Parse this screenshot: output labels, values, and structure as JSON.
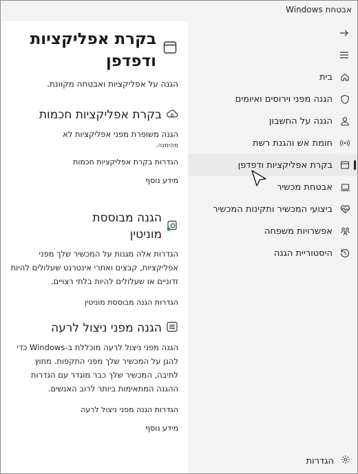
{
  "window": {
    "title": "אבטחת Windows"
  },
  "nav": {
    "items": [
      {
        "label": "בית",
        "icon": "home-icon"
      },
      {
        "label": "הגנה מפני וירוסים ואיומים",
        "icon": "shield-icon"
      },
      {
        "label": "הגנה על החשבון",
        "icon": "person-icon"
      },
      {
        "label": "חומת אש והגנת רשת",
        "icon": "wireless-icon"
      },
      {
        "label": "בקרת אפליקציות ודפדפן",
        "icon": "app-browser-icon",
        "selected": true
      },
      {
        "label": "אבטחת מכשיר",
        "icon": "laptop-icon"
      },
      {
        "label": "ביצועי המכשיר ותקינות המכשיר",
        "icon": "heart-pulse-icon"
      },
      {
        "label": "אפשרויות משפחה",
        "icon": "family-icon"
      },
      {
        "label": "היסטוריית הגנה",
        "icon": "history-icon"
      }
    ],
    "settings_label": "הגדרות"
  },
  "page": {
    "title": "בקרת אפליקציות ודפדפן",
    "subtitle": "הגנה על אפליקציות ואבטחה מקוונת."
  },
  "sections": {
    "smart_app": {
      "title": "בקרת אפליקציות חכמות",
      "text": "הגנה משופרת מפני אפליקציות לא",
      "small": "מהימנה.",
      "settings_link": "הגדרות בקרת אפליקציות חכמות",
      "more_link": "מידע נוסף"
    },
    "reputation": {
      "title": "הגנה מבוססת מוניטין",
      "text": "הגדרות אלה מגנות על המכשיר שלך מפני אפליקציות, קבצים ואתרי אינטרנט שעלולים להיות זדוניים או שעלולים להיות בלתי רצויים.",
      "settings_link": "הגדרות הגנה מבוססת מוניטין"
    },
    "exploit": {
      "title": "הגנה מפני ניצול לרעה",
      "text": "הגנה מפני ניצול לרעה מוכללת ב-Windows כדי להגן על המכשיר שלך מפני התקפות. מחוץ לתיבה, המכשיר שלך כבר מוגדר עם הגדרות ההגנה המתאימות ביותר לרוב האנשים.",
      "settings_link": "הגדרות הגנה מפני ניצול לרעה",
      "more_link": "מידע נוסף"
    }
  }
}
